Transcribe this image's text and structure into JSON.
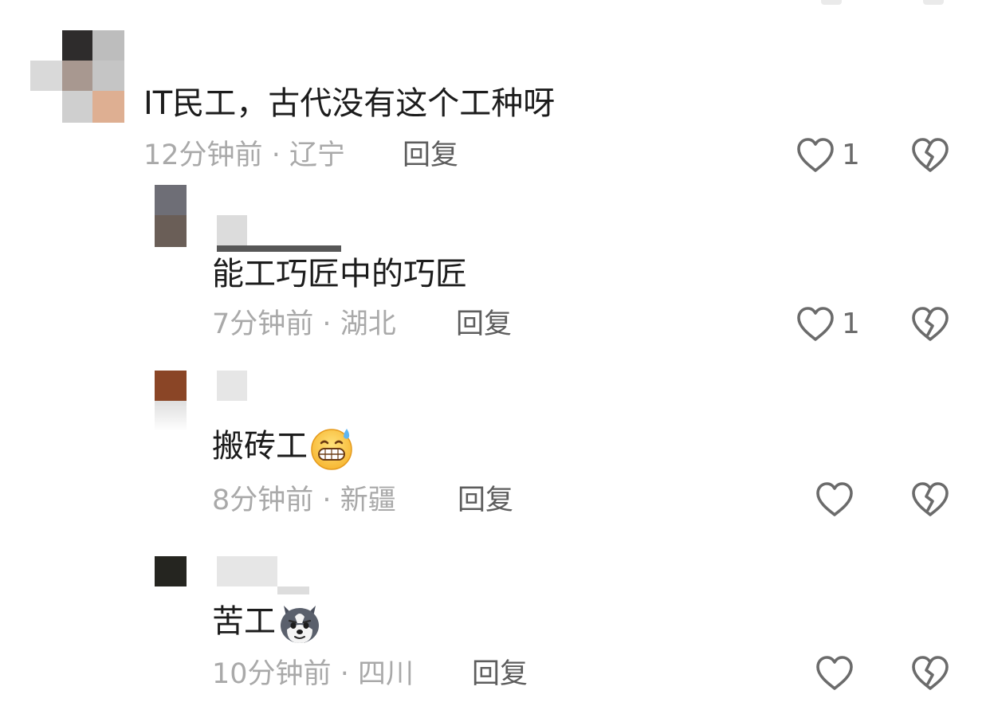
{
  "comments": [
    {
      "text": "IT民工，古代没有这个工种呀",
      "time": "12分钟前",
      "region": "辽宁",
      "reply_label": "回复",
      "likes": "1"
    },
    {
      "text": "能工巧匠中的巧匠",
      "time": "7分钟前",
      "region": "湖北",
      "reply_label": "回复",
      "likes": "1"
    },
    {
      "text": "搬砖工",
      "emoji": "sweat-grin-emoji",
      "time": "8分钟前",
      "region": "新疆",
      "reply_label": "回复",
      "likes": ""
    },
    {
      "text": "苦工",
      "emoji": "husky-dog-emoji",
      "time": "10分钟前",
      "region": "四川",
      "reply_label": "回复",
      "likes": ""
    }
  ],
  "meta_separator": "·",
  "icons": {
    "like": "heart-outline-icon",
    "dislike": "broken-heart-icon"
  },
  "colors": {
    "text": "#1c1c1c",
    "meta": "#a9a9a9",
    "reply": "#5d5d5d",
    "icon": "#6b6b6b"
  }
}
